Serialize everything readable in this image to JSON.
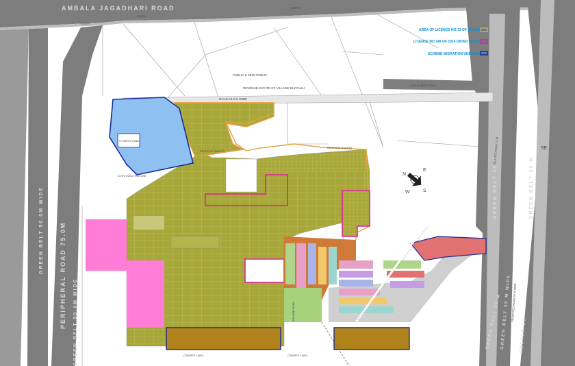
{
  "roads": {
    "ambala_road": "AMBALA  JAGADHARI  ROAD",
    "entry_1": "ENTRY",
    "entry_2": "ENTRY",
    "entry_3": "ENTRY",
    "peripheral_road": "PERIPHERAL  ROAD  75.0M",
    "green_belt_50_top": "GREEN  BELT  50.0M  WIDE",
    "green_belt_50_bottom": "GREEN BELT 50.0M WIDE",
    "road_24m": "ROAD 24.0 M WIDE",
    "road_24m_right": "24.0 M WIDE ROAD",
    "green_belt_30_a": "GREEN  BELT  30 M",
    "green_belt_30_b": "GREEN  BELT  30 M",
    "green_belt_30_c": "GREEN BELT 30 M",
    "green_belt_30_d": "GREEN BELT 30 M WIDE",
    "sector_21": "SECTOR-21",
    "service_road": "SERVICE ROAD 12 M",
    "proposed_road": "PROPOSED ROAD 60 M WIDE",
    "se": "SE"
  },
  "labels": {
    "public_semi_public": "PUBLIC & SEMI PUBLIC",
    "revenue_estate": "REVENUE ESTATE OF VILLAGE BHATAULI",
    "police_line": "POLICE LINE",
    "revenue_rasta_1": "REVENUE RAASTA",
    "revenue_rasta_2": "REVENUE RAASTA",
    "others_land_1": "OTHER'S LAND",
    "others_land_2": "OTHER'S LAND",
    "others_land_3": "OTHER'S LAND",
    "electric_line": "33 KV ELECTRIC LINE",
    "road_18m": "18 M WIDE ROAD"
  },
  "legend": {
    "items": [
      {
        "text": "AREA OF LICENCE NO.73 OF 21-02-2009",
        "color": "#e8a040"
      },
      {
        "text": "LICENCE NO.149 OF 2014 DATED 04/09/2014",
        "color": "#e0219b"
      },
      {
        "text": "SCHEME MIGRATION UNDER DDJAY",
        "color": "#1c2a9a"
      }
    ]
  },
  "compass": {
    "n": "N",
    "e": "E",
    "s": "S",
    "w": "W"
  },
  "colors": {
    "olive": "#a8a83a",
    "blue_zone": "#8fc0f2",
    "pink_zone": "#ff7dd6",
    "brown_strip": "#b0821b",
    "road_grey": "#7d7d7d",
    "licence_pink": "#e0219b",
    "ddjay_blue": "#1c2a9a",
    "licence_orange": "#e8a040"
  }
}
